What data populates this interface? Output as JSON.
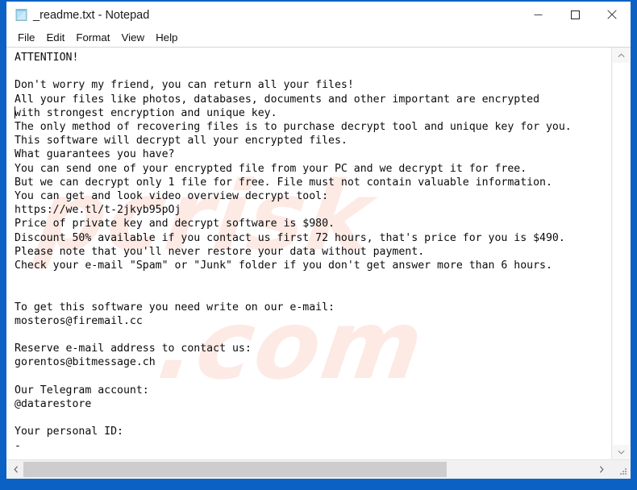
{
  "window": {
    "title": "_readme.txt - Notepad",
    "icon": "notepad-document-icon",
    "frame_color": "#0b62c4",
    "controls": {
      "minimize": "Minimize",
      "maximize": "Maximize",
      "close": "Close"
    }
  },
  "menubar": {
    "items": [
      {
        "label": "File"
      },
      {
        "label": "Edit"
      },
      {
        "label": "Format"
      },
      {
        "label": "View"
      },
      {
        "label": "Help"
      }
    ]
  },
  "document": {
    "file_name": "_readme.txt",
    "watermark_1": "pcrisk",
    "watermark_2": ".com",
    "body": "ATTENTION!\n\nDon't worry my friend, you can return all your files!\nAll your files like photos, databases, documents and other important are encrypted\nwith strongest encryption and unique key.\nThe only method of recovering files is to purchase decrypt tool and unique key for you.\nThis software will decrypt all your encrypted files.\nWhat guarantees you have?\nYou can send one of your encrypted file from your PC and we decrypt it for free.\nBut we can decrypt only 1 file for free. File must not contain valuable information.\nYou can get and look video overview decrypt tool:\nhttps://we.tl/t-2jkyb95pOj\nPrice of private key and decrypt software is $980.\nDiscount 50% available if you contact us first 72 hours, that's price for you is $490.\nPlease note that you'll never restore your data without payment.\nCheck your e-mail \"Spam\" or \"Junk\" folder if you don't get answer more than 6 hours.\n\n\nTo get this software you need write on our e-mail:\nmosteros@firemail.cc\n\nReserve e-mail address to contact us:\ngorentos@bitmessage.ch\n\nOur Telegram account:\n@datarestore\n\nYour personal ID:\n-",
    "details": {
      "price_full": "$980",
      "price_discount": "$490",
      "discount_percent": "50%",
      "discount_window_hours": "72 hours",
      "response_time": "6 hours",
      "free_decrypt_files": "1 file",
      "video_url": "https://we.tl/t-2jkyb95pOj",
      "email_primary": "mosteros@firemail.cc",
      "email_reserve": "gorentos@bitmessage.ch",
      "telegram": "@datarestore",
      "personal_id": "-"
    }
  },
  "scrollbars": {
    "vertical": {
      "up_arrow": "scroll-up",
      "down_arrow": "scroll-down"
    },
    "horizontal": {
      "left_arrow": "scroll-left",
      "right_arrow": "scroll-right"
    }
  }
}
